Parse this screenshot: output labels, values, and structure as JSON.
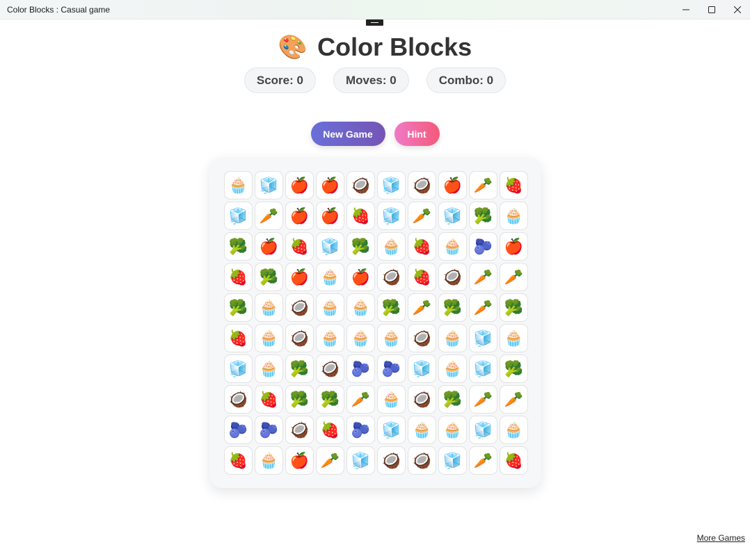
{
  "window": {
    "title": "Color Blocks : Casual game",
    "controls": [
      "minimize",
      "maximize",
      "close"
    ]
  },
  "header": {
    "logo_icon": "🎨",
    "title": "Color Blocks"
  },
  "stats": {
    "score": "Score: 0",
    "moves": "Moves: 0",
    "combo": "Combo: 0"
  },
  "buttons": {
    "new_game": "New Game",
    "hint": "Hint"
  },
  "colors": {
    "new_game_gradient": [
      "#6a6fd8",
      "#7554b5"
    ],
    "hint_gradient": [
      "#f07ac6",
      "#f35a7a"
    ]
  },
  "board": {
    "legend": {
      "cupcake": "🧁",
      "ice": "🧊",
      "apple": "🍎",
      "coconut": "🥥",
      "carrot": "🥕",
      "strawberry": "🍓",
      "broccoli": "🥦",
      "blueberries": "🫐"
    },
    "rows": [
      [
        "cupcake",
        "ice",
        "apple",
        "apple",
        "coconut",
        "ice",
        "coconut",
        "apple",
        "carrot",
        "strawberry"
      ],
      [
        "ice",
        "carrot",
        "apple",
        "apple",
        "strawberry",
        "ice",
        "carrot",
        "ice",
        "broccoli",
        "cupcake"
      ],
      [
        "broccoli",
        "apple",
        "strawberry",
        "ice",
        "broccoli",
        "cupcake",
        "strawberry",
        "cupcake",
        "blueberries",
        "apple"
      ],
      [
        "strawberry",
        "broccoli",
        "apple",
        "cupcake",
        "apple",
        "coconut",
        "strawberry",
        "coconut",
        "carrot",
        "carrot"
      ],
      [
        "broccoli",
        "cupcake",
        "coconut",
        "cupcake",
        "cupcake",
        "broccoli",
        "carrot",
        "broccoli",
        "carrot",
        "broccoli"
      ],
      [
        "strawberry",
        "cupcake",
        "coconut",
        "cupcake",
        "cupcake",
        "cupcake",
        "coconut",
        "cupcake",
        "ice",
        "cupcake"
      ],
      [
        "ice",
        "cupcake",
        "broccoli",
        "coconut",
        "blueberries",
        "blueberries",
        "ice",
        "cupcake",
        "ice",
        "broccoli"
      ],
      [
        "coconut",
        "strawberry",
        "broccoli",
        "broccoli",
        "carrot",
        "cupcake",
        "coconut",
        "broccoli",
        "carrot",
        "carrot"
      ],
      [
        "blueberries",
        "blueberries",
        "coconut",
        "strawberry",
        "blueberries",
        "ice",
        "cupcake",
        "cupcake",
        "ice",
        "cupcake"
      ],
      [
        "strawberry",
        "cupcake",
        "apple",
        "carrot",
        "ice",
        "coconut",
        "coconut",
        "ice",
        "carrot",
        "strawberry"
      ]
    ]
  },
  "footer": {
    "more_games": "More Games"
  }
}
